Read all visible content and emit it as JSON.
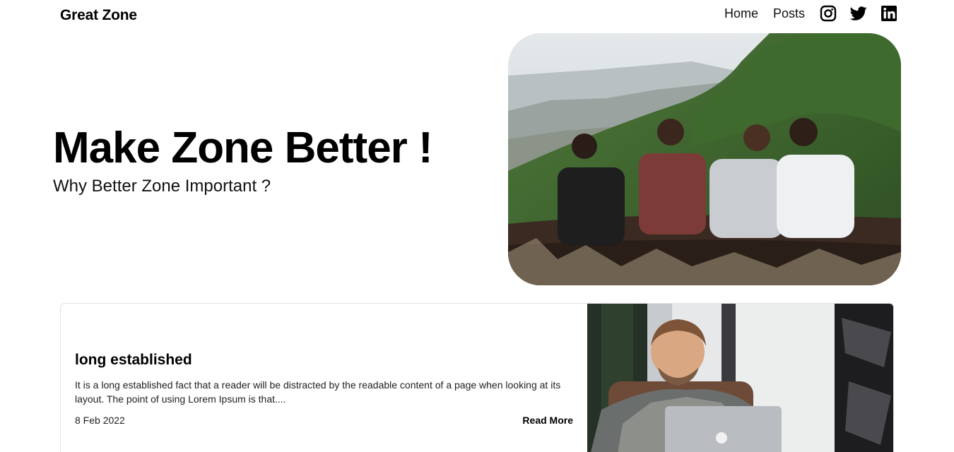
{
  "brand": {
    "name": "Great Zone"
  },
  "nav": {
    "links": [
      {
        "label": "Home"
      },
      {
        "label": "Posts"
      }
    ],
    "social_icons": [
      "instagram-icon",
      "twitter-icon",
      "linkedin-icon"
    ]
  },
  "hero": {
    "title": "Make Zone Better !",
    "subtitle": "Why Better Zone Important ?",
    "image": "four friends sitting on a green mountain ridge"
  },
  "post": {
    "title": "long established",
    "excerpt": "It is a long established fact that a reader will be distracted by the readable content of a page when looking at its layout. The point of using Lorem Ipsum is that....",
    "date": "8 Feb 2022",
    "read_more": "Read More",
    "image": "smiling man working on a laptop"
  },
  "colors": {
    "text": "#000000",
    "background": "#ffffff",
    "card_border": "#e2e2e2"
  }
}
